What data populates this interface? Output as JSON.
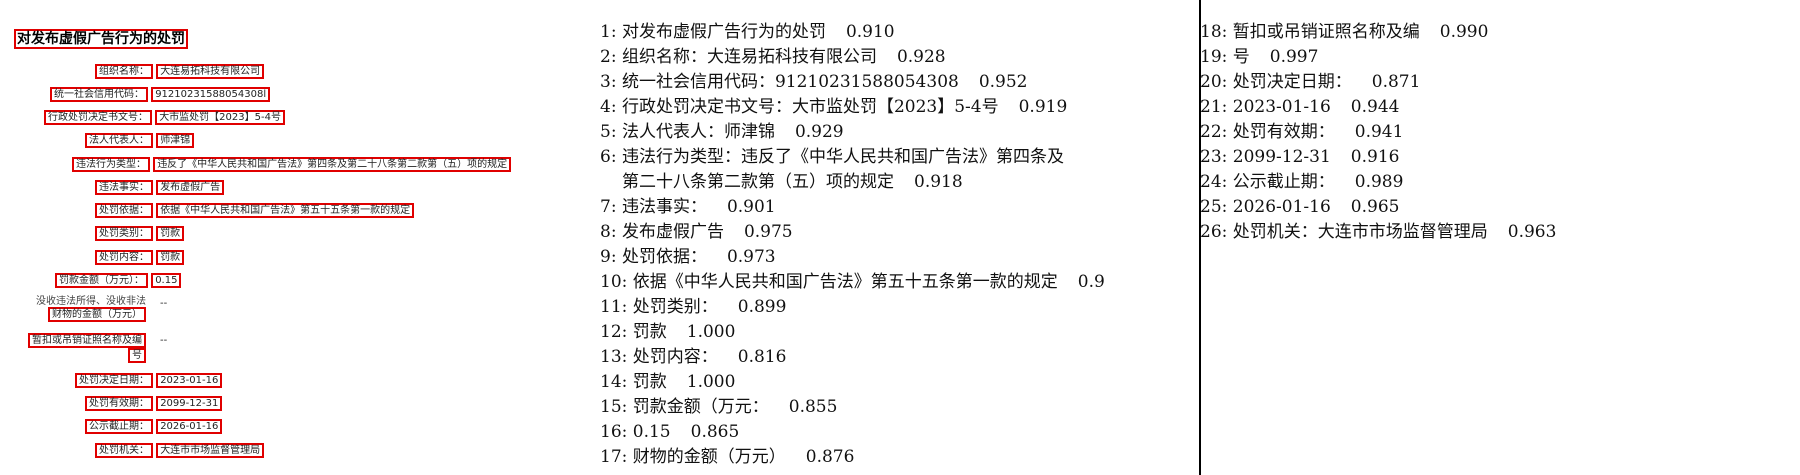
{
  "document": {
    "title": "对发布虚假广告行为的处罚",
    "fields": [
      {
        "label": "组织名称：",
        "value": "大连易拓科技有限公司"
      },
      {
        "label": "统一社会信用代码：",
        "value": "91210231588054308l"
      },
      {
        "label": "行政处罚决定书文号：",
        "value": "大市监处罚【2023】5-4号"
      },
      {
        "label": "法人代表人：",
        "value": "师津锦"
      },
      {
        "label": "违法行为类型：",
        "value": "违反了《中华人民共和国广告法》第四条及第二十八条第二款第（五）项的规定"
      },
      {
        "label": "违法事实：",
        "value": "发布虚假广告"
      },
      {
        "label": "处罚依据：",
        "value": "依据《中华人民共和国广告法》第五十五条第一款的规定"
      },
      {
        "label": "处罚类别：",
        "value": "罚款"
      },
      {
        "label": "处罚内容：",
        "value": "罚款"
      },
      {
        "label": "罚款金额（万元）：",
        "value": "0.15"
      },
      {
        "label_line1": "没收违法所得、没收非法",
        "label_line2": "财物的金额（万元）",
        "value": "--"
      },
      {
        "label_line1": "暂扣或吊销证照名称及编",
        "label_line2": "号",
        "value": "--"
      },
      {
        "label": "处罚决定日期：",
        "value": "2023-01-16"
      },
      {
        "label": "处罚有效期：",
        "value": "2099-12-31"
      },
      {
        "label": "公示截止期：",
        "value": "2026-01-16"
      },
      {
        "label": "处罚机关：",
        "value": "大连市市场监督管理局"
      }
    ]
  },
  "ocr_left": [
    {
      "index": "1:",
      "text": "对发布虚假广告行为的处罚",
      "score": "0.910"
    },
    {
      "index": "2:",
      "text": "组织名称：大连易拓科技有限公司",
      "score": "0.928"
    },
    {
      "index": "3:",
      "text": "统一社会信用代码：91210231588054308",
      "score": "0.952"
    },
    {
      "index": "4:",
      "text": "行政处罚决定书文号：大市监处罚【2023】5-4号",
      "score": "0.919"
    },
    {
      "index": "5:",
      "text": "法人代表人：师津锦",
      "score": "0.929"
    },
    {
      "index": "6:",
      "text": "违法行为类型：违反了《中华人民共和国广告法》第四条及",
      "cont": "第二十八条第二款第（五）项的规定",
      "score": "0.918"
    },
    {
      "index": "7:",
      "text": "违法事实：",
      "score": "0.901"
    },
    {
      "index": "8:",
      "text": "发布虚假广告",
      "score": "0.975"
    },
    {
      "index": "9:",
      "text": "处罚依据：",
      "score": "0.973"
    },
    {
      "index": "10:",
      "text": "依据《中华人民共和国广告法》第五十五条第一款的规定",
      "score": "0.9"
    },
    {
      "index": "11:",
      "text": "处罚类别：",
      "score": "0.899"
    },
    {
      "index": "12:",
      "text": "罚款",
      "score": "1.000"
    },
    {
      "index": "13:",
      "text": "处罚内容：",
      "score": "0.816"
    },
    {
      "index": "14:",
      "text": "罚款",
      "score": "1.000"
    },
    {
      "index": "15:",
      "text": "罚款金额（万元：",
      "score": "0.855"
    },
    {
      "index": "16:",
      "text": "0.15",
      "score": "0.865"
    },
    {
      "index": "17:",
      "text": "财物的金额（万元）",
      "score": "0.876"
    }
  ],
  "ocr_right": [
    {
      "index": "18:",
      "text": "暂扣或吊销证照名称及编",
      "score": "0.990"
    },
    {
      "index": "19:",
      "text": "号",
      "score": "0.997"
    },
    {
      "index": "20:",
      "text": "处罚决定日期：",
      "score": "0.871"
    },
    {
      "index": "21:",
      "text": "2023-01-16",
      "score": "0.944"
    },
    {
      "index": "22:",
      "text": "处罚有效期：",
      "score": "0.941"
    },
    {
      "index": "23:",
      "text": "2099-12-31",
      "score": "0.916"
    },
    {
      "index": "24:",
      "text": "公示截止期：",
      "score": "0.989"
    },
    {
      "index": "25:",
      "text": "2026-01-16",
      "score": "0.965"
    },
    {
      "index": "26:",
      "text": "处罚机关：大连市市场监督管理局",
      "score": "0.963"
    }
  ]
}
